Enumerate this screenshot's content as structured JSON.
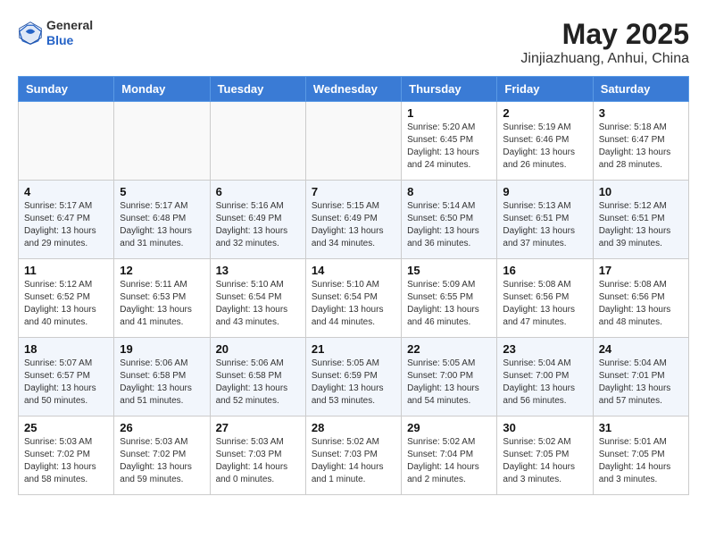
{
  "header": {
    "logo_line1": "General",
    "logo_line2": "Blue",
    "month": "May 2025",
    "location": "Jinjiazhuang, Anhui, China"
  },
  "weekdays": [
    "Sunday",
    "Monday",
    "Tuesday",
    "Wednesday",
    "Thursday",
    "Friday",
    "Saturday"
  ],
  "weeks": [
    [
      {
        "day": "",
        "info": ""
      },
      {
        "day": "",
        "info": ""
      },
      {
        "day": "",
        "info": ""
      },
      {
        "day": "",
        "info": ""
      },
      {
        "day": "1",
        "info": "Sunrise: 5:20 AM\nSunset: 6:45 PM\nDaylight: 13 hours\nand 24 minutes."
      },
      {
        "day": "2",
        "info": "Sunrise: 5:19 AM\nSunset: 6:46 PM\nDaylight: 13 hours\nand 26 minutes."
      },
      {
        "day": "3",
        "info": "Sunrise: 5:18 AM\nSunset: 6:47 PM\nDaylight: 13 hours\nand 28 minutes."
      }
    ],
    [
      {
        "day": "4",
        "info": "Sunrise: 5:17 AM\nSunset: 6:47 PM\nDaylight: 13 hours\nand 29 minutes."
      },
      {
        "day": "5",
        "info": "Sunrise: 5:17 AM\nSunset: 6:48 PM\nDaylight: 13 hours\nand 31 minutes."
      },
      {
        "day": "6",
        "info": "Sunrise: 5:16 AM\nSunset: 6:49 PM\nDaylight: 13 hours\nand 32 minutes."
      },
      {
        "day": "7",
        "info": "Sunrise: 5:15 AM\nSunset: 6:49 PM\nDaylight: 13 hours\nand 34 minutes."
      },
      {
        "day": "8",
        "info": "Sunrise: 5:14 AM\nSunset: 6:50 PM\nDaylight: 13 hours\nand 36 minutes."
      },
      {
        "day": "9",
        "info": "Sunrise: 5:13 AM\nSunset: 6:51 PM\nDaylight: 13 hours\nand 37 minutes."
      },
      {
        "day": "10",
        "info": "Sunrise: 5:12 AM\nSunset: 6:51 PM\nDaylight: 13 hours\nand 39 minutes."
      }
    ],
    [
      {
        "day": "11",
        "info": "Sunrise: 5:12 AM\nSunset: 6:52 PM\nDaylight: 13 hours\nand 40 minutes."
      },
      {
        "day": "12",
        "info": "Sunrise: 5:11 AM\nSunset: 6:53 PM\nDaylight: 13 hours\nand 41 minutes."
      },
      {
        "day": "13",
        "info": "Sunrise: 5:10 AM\nSunset: 6:54 PM\nDaylight: 13 hours\nand 43 minutes."
      },
      {
        "day": "14",
        "info": "Sunrise: 5:10 AM\nSunset: 6:54 PM\nDaylight: 13 hours\nand 44 minutes."
      },
      {
        "day": "15",
        "info": "Sunrise: 5:09 AM\nSunset: 6:55 PM\nDaylight: 13 hours\nand 46 minutes."
      },
      {
        "day": "16",
        "info": "Sunrise: 5:08 AM\nSunset: 6:56 PM\nDaylight: 13 hours\nand 47 minutes."
      },
      {
        "day": "17",
        "info": "Sunrise: 5:08 AM\nSunset: 6:56 PM\nDaylight: 13 hours\nand 48 minutes."
      }
    ],
    [
      {
        "day": "18",
        "info": "Sunrise: 5:07 AM\nSunset: 6:57 PM\nDaylight: 13 hours\nand 50 minutes."
      },
      {
        "day": "19",
        "info": "Sunrise: 5:06 AM\nSunset: 6:58 PM\nDaylight: 13 hours\nand 51 minutes."
      },
      {
        "day": "20",
        "info": "Sunrise: 5:06 AM\nSunset: 6:58 PM\nDaylight: 13 hours\nand 52 minutes."
      },
      {
        "day": "21",
        "info": "Sunrise: 5:05 AM\nSunset: 6:59 PM\nDaylight: 13 hours\nand 53 minutes."
      },
      {
        "day": "22",
        "info": "Sunrise: 5:05 AM\nSunset: 7:00 PM\nDaylight: 13 hours\nand 54 minutes."
      },
      {
        "day": "23",
        "info": "Sunrise: 5:04 AM\nSunset: 7:00 PM\nDaylight: 13 hours\nand 56 minutes."
      },
      {
        "day": "24",
        "info": "Sunrise: 5:04 AM\nSunset: 7:01 PM\nDaylight: 13 hours\nand 57 minutes."
      }
    ],
    [
      {
        "day": "25",
        "info": "Sunrise: 5:03 AM\nSunset: 7:02 PM\nDaylight: 13 hours\nand 58 minutes."
      },
      {
        "day": "26",
        "info": "Sunrise: 5:03 AM\nSunset: 7:02 PM\nDaylight: 13 hours\nand 59 minutes."
      },
      {
        "day": "27",
        "info": "Sunrise: 5:03 AM\nSunset: 7:03 PM\nDaylight: 14 hours\nand 0 minutes."
      },
      {
        "day": "28",
        "info": "Sunrise: 5:02 AM\nSunset: 7:03 PM\nDaylight: 14 hours\nand 1 minute."
      },
      {
        "day": "29",
        "info": "Sunrise: 5:02 AM\nSunset: 7:04 PM\nDaylight: 14 hours\nand 2 minutes."
      },
      {
        "day": "30",
        "info": "Sunrise: 5:02 AM\nSunset: 7:05 PM\nDaylight: 14 hours\nand 3 minutes."
      },
      {
        "day": "31",
        "info": "Sunrise: 5:01 AM\nSunset: 7:05 PM\nDaylight: 14 hours\nand 3 minutes."
      }
    ]
  ]
}
